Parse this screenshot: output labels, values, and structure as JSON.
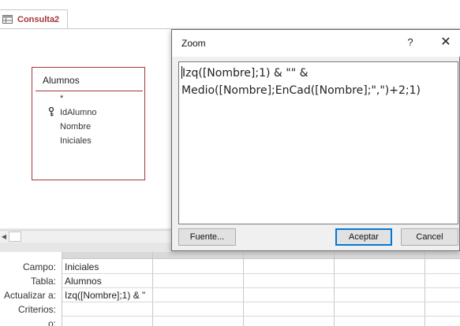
{
  "tab": {
    "label": "Consulta2",
    "icon": "query-icon",
    "accent": "#a4373a"
  },
  "table_box": {
    "title": "Alumnos",
    "fields": [
      "*",
      "IdAlumno",
      "Nombre",
      "Iniciales"
    ],
    "key_icon": "primary-key-icon",
    "border_color": "#a4373a"
  },
  "grid": {
    "row_labels": [
      "Campo:",
      "Tabla:",
      "Actualizar a:",
      "Criterios:",
      "o:"
    ],
    "column1": [
      "Iniciales",
      "Alumnos",
      "Izq([Nombre];1) & \""
    ]
  },
  "zoom_dialog": {
    "title": "Zoom",
    "help_label": "?",
    "close_label": "✕",
    "expression_line1": "Izq([Nombre];1) & \"\" &",
    "expression_line2": "Medio([Nombre];EnCad([Nombre];\",\")+2;1)",
    "font_button": "Fuente...",
    "ok_button": "Aceptar",
    "cancel_button": "Cancel"
  }
}
